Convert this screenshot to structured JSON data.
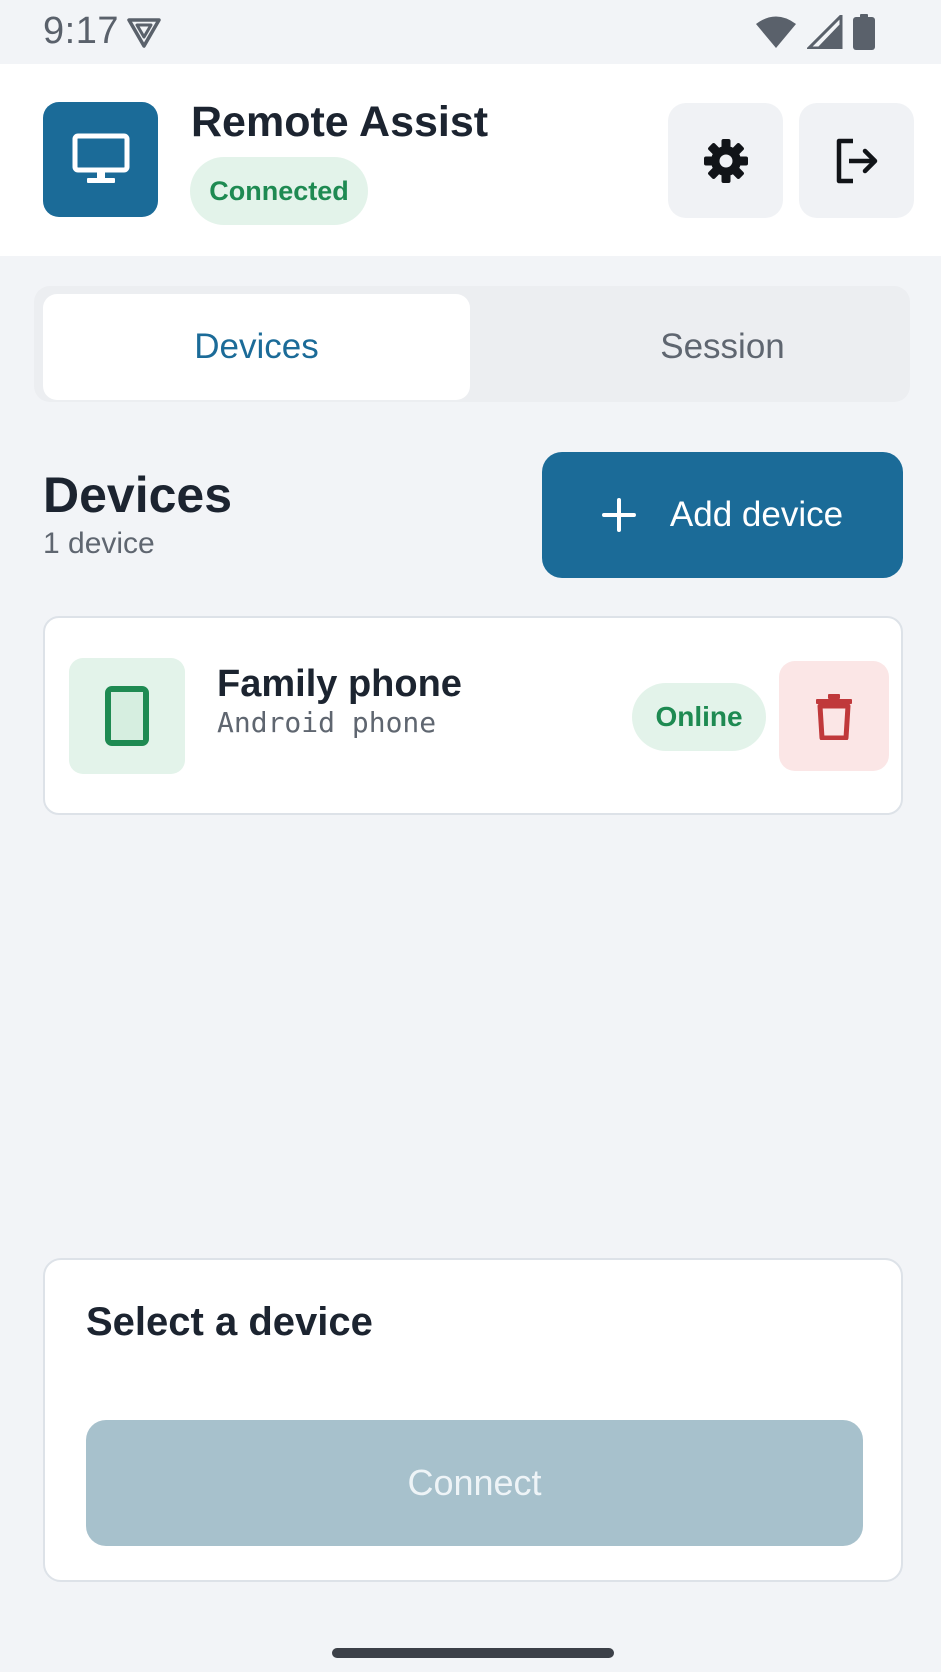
{
  "status_bar": {
    "time": "9:17",
    "icons": [
      "vpn-shield-icon",
      "wifi-icon",
      "cell-signal-icon",
      "battery-icon"
    ]
  },
  "header": {
    "app_title": "Remote Assist",
    "connection_status": "Connected",
    "logo_icon": "monitor-icon",
    "settings_icon": "gear-icon",
    "logout_icon": "logout-icon"
  },
  "tabs": [
    {
      "label": "Devices",
      "active": true
    },
    {
      "label": "Session",
      "active": false
    }
  ],
  "devices_section": {
    "title": "Devices",
    "count_text": "1 device",
    "add_button_label": "Add device"
  },
  "devices": [
    {
      "name": "Family phone",
      "type": "Android phone",
      "status": "Online",
      "icon": "phone-icon"
    }
  ],
  "bottom_panel": {
    "title": "Select a device",
    "connect_label": "Connect"
  },
  "colors": {
    "primary": "#1b6b98",
    "success": "#1e8a52",
    "success_bg": "#e3f3ea",
    "danger": "#c0393b",
    "danger_bg": "#fbe6e6",
    "disabled": "#a7c1cc"
  }
}
